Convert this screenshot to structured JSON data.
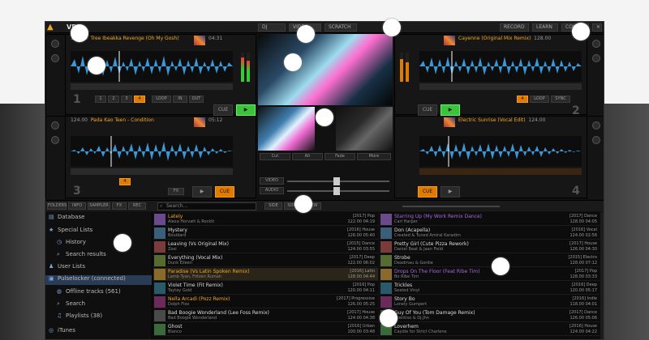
{
  "window": {
    "logo_text": "VDJ",
    "top_buttons": [
      "RECORD",
      "LEARN",
      "CONFIG"
    ],
    "mid_tabs": [
      "DJ",
      "VIDEO",
      "SCRATCH"
    ],
    "close": "✕"
  },
  "decks": [
    {
      "id": "1",
      "title": "Tree Ibeakka Revenge (Oh My Gosh)",
      "meta": "128.00",
      "time": "04:31",
      "side": "left"
    },
    {
      "id": "2",
      "title": "Cayenne (Original Mix Remix)",
      "meta": "128.00",
      "time": "03:58",
      "side": "right"
    },
    {
      "id": "3",
      "title": "Pada Kao Teen - Condition",
      "meta": "124.00",
      "time": "05:12",
      "side": "left"
    },
    {
      "id": "4",
      "title": "Electric Sunrise (Vocal Edit)",
      "meta": "124.00",
      "time": "06:03",
      "side": "right"
    }
  ],
  "deck_controls": {
    "cue": "CUE",
    "play": "▶",
    "pad_labels": [
      "1",
      "2",
      "3",
      "4",
      "5",
      "6",
      "7",
      "8"
    ],
    "loop_labels": [
      "LOOP",
      "IN",
      "OUT"
    ],
    "sync": "SYNC",
    "fx": "FX"
  },
  "mixer": {
    "video_buttons": [
      "Cut",
      "Alt",
      "Fade",
      "More"
    ],
    "video_label": "VIDEO",
    "audio_label": "AUDIO"
  },
  "browser": {
    "tabs": [
      "FOLDERS",
      "INFO",
      "SAMPLER",
      "FX",
      "REC"
    ],
    "search_placeholder": "Search...",
    "toolbar_buttons": [
      "SIDE",
      "SORT",
      "VIEW"
    ],
    "tree": [
      {
        "icon": "▤",
        "label": "Database"
      },
      {
        "icon": "★",
        "label": "Special Lists"
      },
      {
        "icon": "◷",
        "label": "History"
      },
      {
        "icon": "⌕",
        "label": "Search results"
      },
      {
        "icon": "♟",
        "label": "User Lists"
      },
      {
        "icon": "▣",
        "label": "Pulselocker (connected)"
      },
      {
        "icon": "◍",
        "label": "Offline tracks (561)"
      },
      {
        "icon": "⌕",
        "label": "Search"
      },
      {
        "icon": "♫",
        "label": "Playlists (38)"
      },
      {
        "icon": "◎",
        "label": "iTunes"
      }
    ],
    "list_left": [
      {
        "t1": "Lately",
        "t2": "Alexa Horvatt & Rocktt",
        "r1": "[2017] Pop",
        "r2": "122.00 04:19",
        "hl": true
      },
      {
        "t1": "Mystery",
        "t2": "Bouldard",
        "r1": "[2016] House",
        "r2": "126.00 05:40",
        "hl": false
      },
      {
        "t1": "Leaving (Vs Original Mix)",
        "t2": "Zoxi",
        "r1": "[2015] Dance",
        "r2": "124.00 03:55",
        "hl": false
      },
      {
        "t1": "Everything (Vocal Mix)",
        "t2": "Dunk Eileen",
        "r1": "[2017] Deep",
        "r2": "122.00 06:02",
        "hl": false
      },
      {
        "t1": "Paradise (Vs Latin Spoken Remix)",
        "t2": "Lamb Tyan, Fritzen Rumah",
        "r1": "[2016] Latin",
        "r2": "128.00 04:44",
        "hl": true
      },
      {
        "t1": "Violet Time (Fit Remix)",
        "t2": "Taytay Gold",
        "r1": "[2016] Pop",
        "r2": "120.00 04:11",
        "hl": false
      },
      {
        "t1": "Nella Arcadi (Pozz Remix)",
        "t2": "Dolph Flox",
        "r1": "[2017] Progressive",
        "r2": "126.00 05:25",
        "hl": true
      },
      {
        "t1": "Bad Boogie Wonderland (Lee Foss Remix)",
        "t2": "Bad Boogie Wonderland",
        "r1": "[2017] House",
        "r2": "124.00 04:38",
        "hl": false
      },
      {
        "t1": "Ghost",
        "t2": "Blanco",
        "r1": "[2016] Urban",
        "r2": "100.00 03:48",
        "hl": false
      }
    ],
    "list_right": [
      {
        "t1": "Starring Up (My Work Remix Dance)",
        "t2": "Carl Harper",
        "r1": "[2017] Dance",
        "r2": "128.00 04:05",
        "pur": true
      },
      {
        "t1": "Don (Acapella)",
        "t2": "Created & Tuned Amiral Karadim",
        "r1": "[2016] Vocal",
        "r2": "124.00 02:56",
        "pur": false
      },
      {
        "t1": "Pretty Girl (Cute Pizza Rework)",
        "t2": "Daniel Beat & Jaan Field",
        "r1": "[2017] House",
        "r2": "126.00 04:30",
        "pur": false
      },
      {
        "t1": "Strobe",
        "t2": "Deadmau & Gordie",
        "r1": "[2015] Electro",
        "r2": "128.00 07:12",
        "pur": false
      },
      {
        "t1": "Drops On The Floor (Feat Ribe Tim)",
        "t2": "Bo Ribe Tim",
        "r1": "[2017] Pop",
        "r2": "128.00 03:33",
        "pur": true
      },
      {
        "t1": "Trickles",
        "t2": "Seated Vinyl",
        "r1": "[2016] Deep",
        "r2": "120.00 05:17",
        "pur": false
      },
      {
        "t1": "Story Bo",
        "t2": "Lonely Gumpert",
        "r1": "[2016] Indie",
        "r2": "118.00 04:01",
        "pur": false
      },
      {
        "t1": "Guy Of You (Tom Damage Remix)",
        "t2": "Scentiso & Dj.Jhn",
        "r1": "[2017] Dance",
        "r2": "126.00 05:06",
        "pur": false
      },
      {
        "t1": "Loverhem",
        "t2": "Caydie for Strict Charlene",
        "r1": "[2016] House",
        "r2": "124.00 04:22",
        "pur": false
      }
    ]
  },
  "colors": {
    "accent": "#f5a623",
    "wave": "#3ea8ee",
    "play": "#3bc33b",
    "highlight_purple": "#a36be0"
  }
}
